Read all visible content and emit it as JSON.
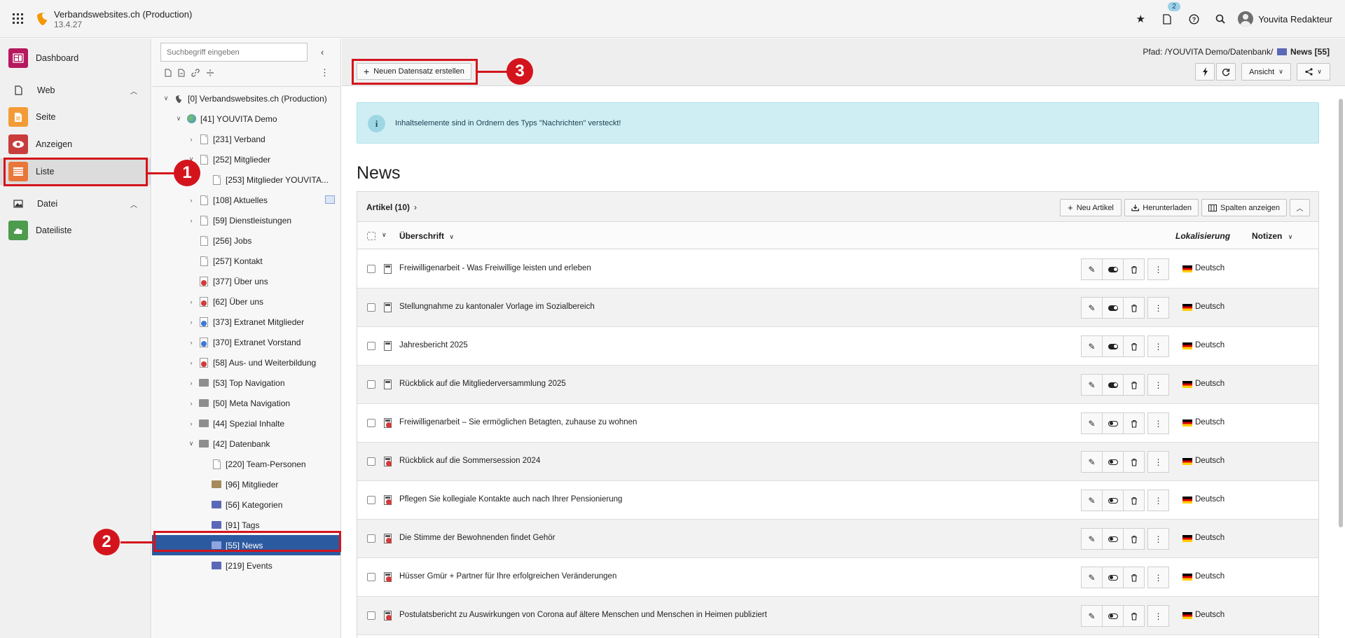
{
  "topbar": {
    "site_name": "Verbandswebsites.ch (Production)",
    "version": "13.4.27",
    "notification_count": "2",
    "user_name": "Youvita Redakteur"
  },
  "modules": {
    "dashboard": "Dashboard",
    "web_group": "Web",
    "seite": "Seite",
    "anzeigen": "Anzeigen",
    "liste": "Liste",
    "datei_group": "Datei",
    "dateiliste": "Dateiliste"
  },
  "tree": {
    "search_placeholder": "Suchbegriff eingeben",
    "nodes": [
      {
        "label": "[0] Verbandswebsites.ch (Production)"
      },
      {
        "label": "[41] YOUVITA Demo"
      },
      {
        "label": "[231] Verband"
      },
      {
        "label": "[252] Mitglieder"
      },
      {
        "label": "[253] Mitglieder YOUVITA..."
      },
      {
        "label": "[108] Aktuelles"
      },
      {
        "label": "[59] Dienstleistungen"
      },
      {
        "label": "[256] Jobs"
      },
      {
        "label": "[257] Kontakt"
      },
      {
        "label": "[377] Über uns"
      },
      {
        "label": "[62] Über uns"
      },
      {
        "label": "[373] Extranet Mitglieder"
      },
      {
        "label": "[370] Extranet Vorstand"
      },
      {
        "label": "[58] Aus- und Weiterbildung"
      },
      {
        "label": "[53] Top Navigation"
      },
      {
        "label": "[50] Meta Navigation"
      },
      {
        "label": "[44] Spezial Inhalte"
      },
      {
        "label": "[42] Datenbank"
      },
      {
        "label": "[220] Team-Personen"
      },
      {
        "label": "[96] Mitglieder"
      },
      {
        "label": "[56] Kategorien"
      },
      {
        "label": "[91] Tags"
      },
      {
        "label": "[55] News"
      },
      {
        "label": "[219] Events"
      }
    ]
  },
  "docheader": {
    "path_prefix": "Pfad: /YOUVITA Demo/Datenbank/",
    "path_current": "News [55]",
    "new_record_label": "Neuen Datensatz erstellen",
    "view_label": "Ansicht"
  },
  "callout": {
    "text": "Inhaltselemente sind in Ordnern des Typs \"Nachrichten\" versteckt!"
  },
  "page": {
    "title": "News"
  },
  "table": {
    "title": "Artikel (10)",
    "btn_new": "Neu Artikel",
    "btn_download": "Herunterladen",
    "btn_columns": "Spalten anzeigen",
    "col_heading": "Überschrift",
    "col_localization": "Lokalisierung",
    "col_notes": "Notizen",
    "rows": [
      {
        "title": "Freiwilligenarbeit - Was Freiwillige leisten und erleben",
        "lang": "Deutsch"
      },
      {
        "title": "Stellungnahme zu kantonaler Vorlage im Sozialbereich",
        "lang": "Deutsch"
      },
      {
        "title": "Jahresbericht 2025",
        "lang": "Deutsch"
      },
      {
        "title": "Rückblick auf die Mitgliederversammlung 2025",
        "lang": "Deutsch"
      },
      {
        "title": "Freiwilligenarbeit – Sie ermöglichen Betagten, zuhause zu wohnen",
        "lang": "Deutsch"
      },
      {
        "title": "Rückblick auf die Sommersession 2024",
        "lang": "Deutsch"
      },
      {
        "title": "Pflegen Sie kollegiale Kontakte auch nach Ihrer Pensionierung",
        "lang": "Deutsch"
      },
      {
        "title": "Die Stimme der Bewohnenden findet Gehör",
        "lang": "Deutsch"
      },
      {
        "title": "Hüsser Gmür + Partner für Ihre erfolgreichen Veränderungen",
        "lang": "Deutsch"
      },
      {
        "title": "Postulatsbericht zu Auswirkungen von Corona auf ältere Menschen und Menschen in Heimen publiziert",
        "lang": "Deutsch"
      }
    ]
  },
  "annotations": {
    "marker1": "1",
    "marker2": "2",
    "marker3": "3"
  },
  "colors": {
    "highlight": "#d4141c",
    "selected_node": "#2c5aa0",
    "callout_bg": "#cfeef4"
  }
}
